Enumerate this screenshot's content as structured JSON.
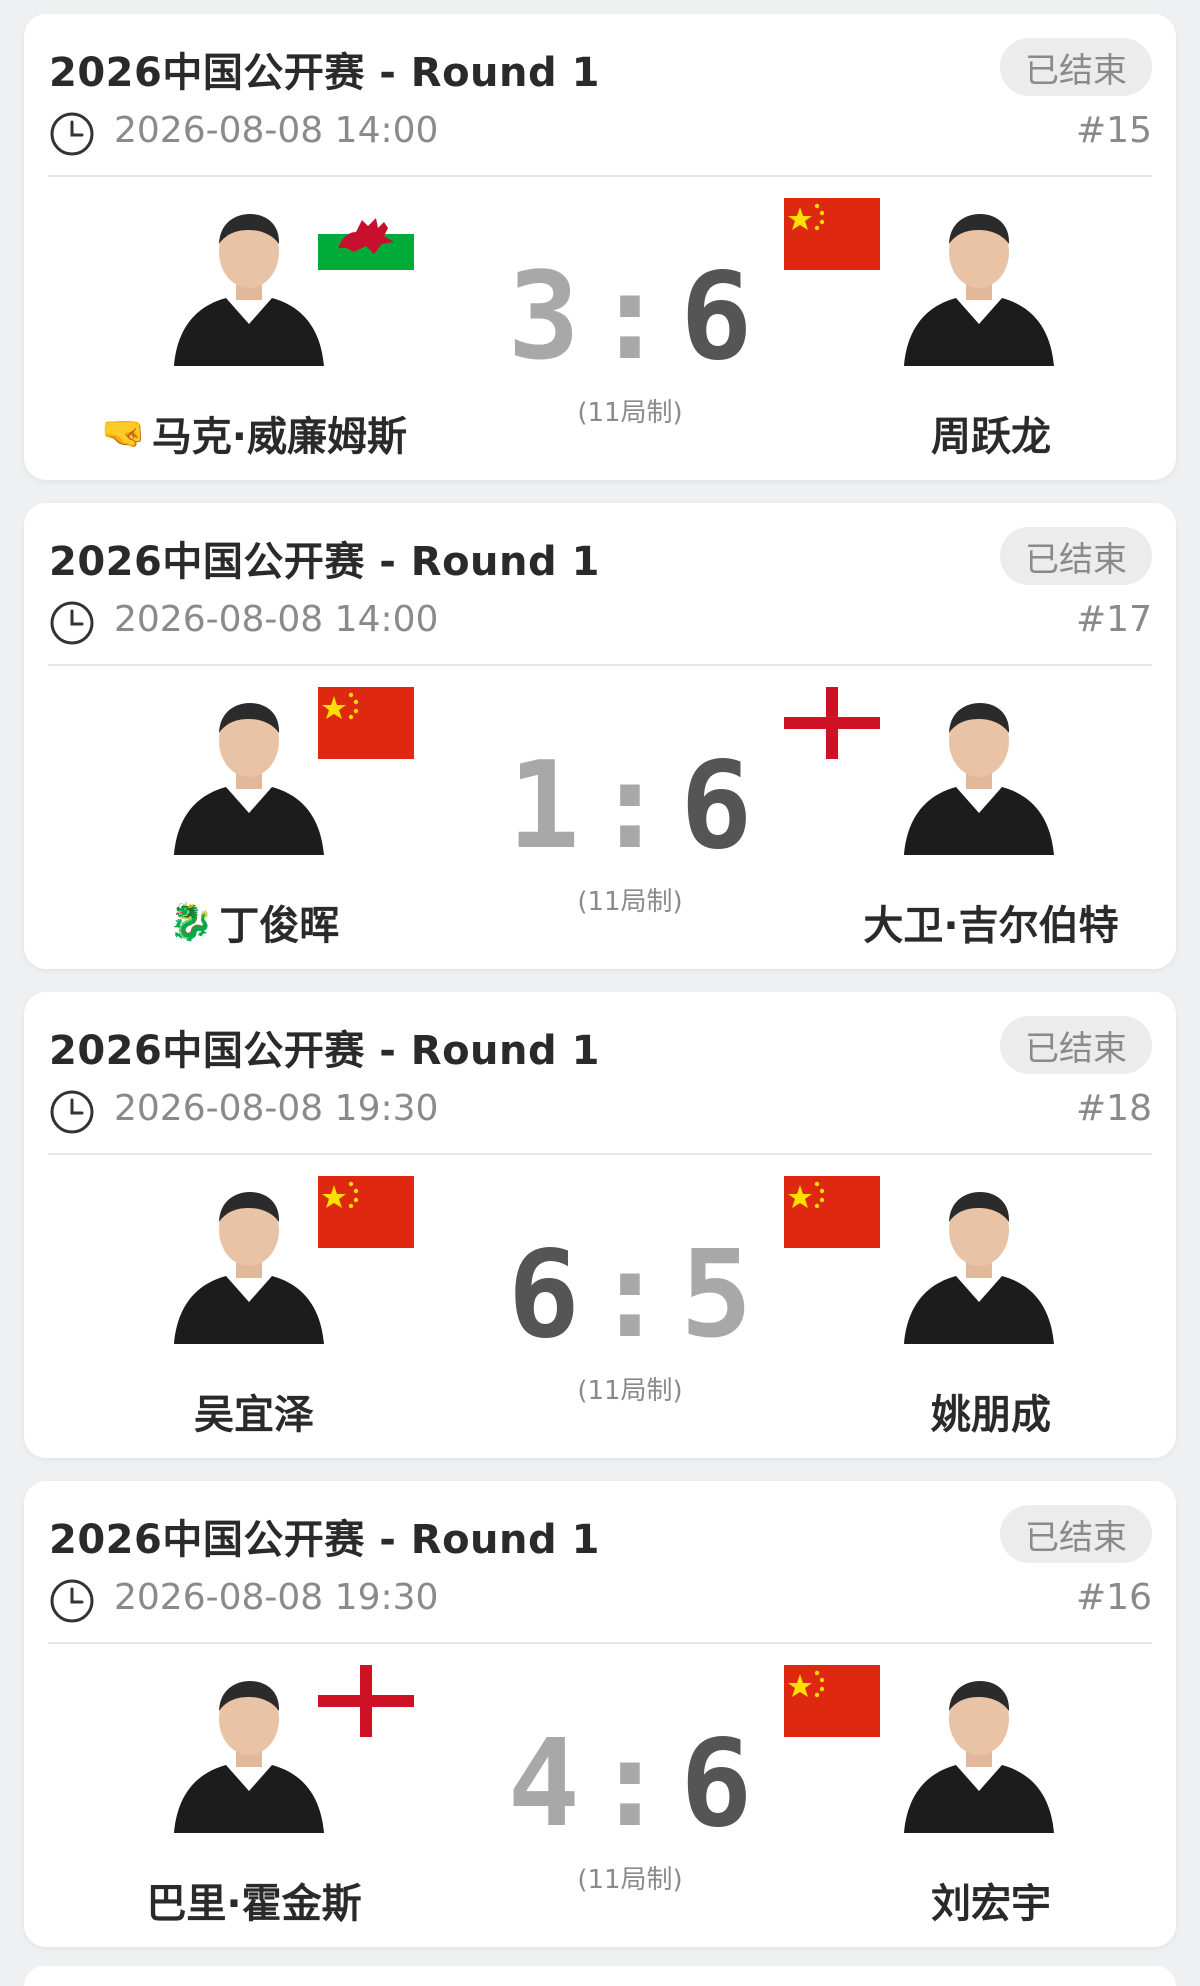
{
  "colors": {
    "card_bg": "#ffffff",
    "page_bg": "#eef0f2",
    "badge_bg": "#ececec",
    "muted_text": "#8a8a8a",
    "score_light": "#a8a8a8",
    "score_dark": "#555555",
    "china_red": "#de2910",
    "china_yellow": "#ffde00",
    "england_red": "#ce1124",
    "wales_green": "#00ab39"
  },
  "matches": [
    {
      "title": "2026中国公开赛 - Round 1",
      "status": "已结束",
      "time": "2026-08-08 14:00",
      "match_no": "#15",
      "left": {
        "name": "马克·威廉姆斯",
        "emoji": "🤜",
        "flag": "wales"
      },
      "right": {
        "name": "周跃龙",
        "emoji": "",
        "flag": "china"
      },
      "score_left": "3",
      "score_right": "6",
      "format": "(11局制)"
    },
    {
      "title": "2026中国公开赛 - Round 1",
      "status": "已结束",
      "time": "2026-08-08 14:00",
      "match_no": "#17",
      "left": {
        "name": "丁俊晖",
        "emoji": "🐉",
        "flag": "china"
      },
      "right": {
        "name": "大卫·吉尔伯特",
        "emoji": "",
        "flag": "england"
      },
      "score_left": "1",
      "score_right": "6",
      "format": "(11局制)"
    },
    {
      "title": "2026中国公开赛 - Round 1",
      "status": "已结束",
      "time": "2026-08-08 19:30",
      "match_no": "#18",
      "left": {
        "name": "吴宜泽",
        "emoji": "",
        "flag": "china"
      },
      "right": {
        "name": "姚朋成",
        "emoji": "",
        "flag": "china"
      },
      "score_left": "6",
      "score_right": "5",
      "format": "(11局制)"
    },
    {
      "title": "2026中国公开赛 - Round 1",
      "status": "已结束",
      "time": "2026-08-08 19:30",
      "match_no": "#16",
      "left": {
        "name": "巴里·霍金斯",
        "emoji": "",
        "flag": "england"
      },
      "right": {
        "name": "刘宏宇",
        "emoji": "",
        "flag": "china"
      },
      "score_left": "4",
      "score_right": "6",
      "format": "(11局制)"
    }
  ]
}
